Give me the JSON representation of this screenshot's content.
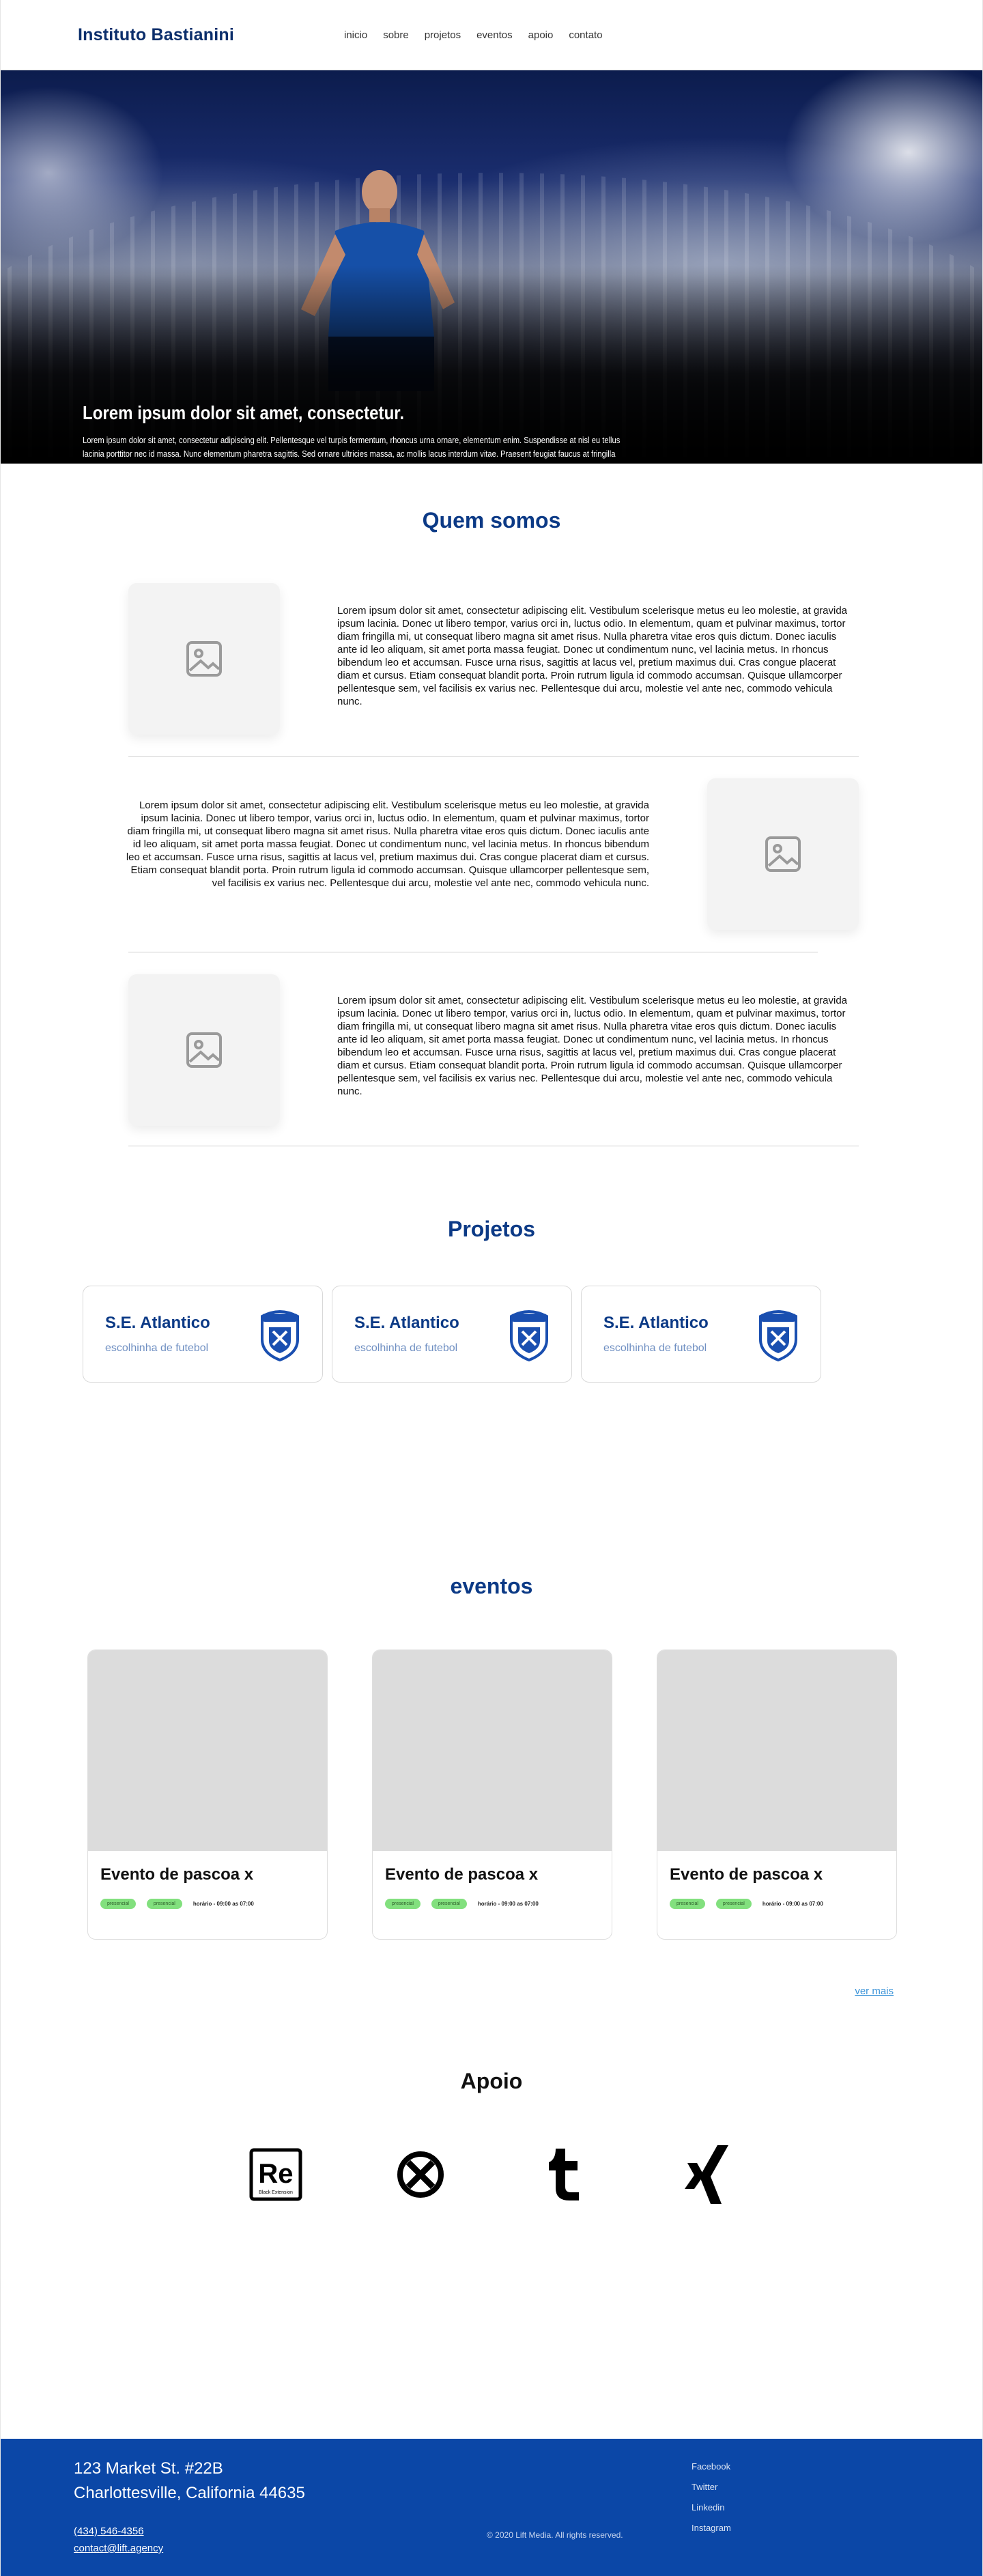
{
  "header": {
    "brand": "Instituto Bastianini",
    "nav": [
      "inicio",
      "sobre",
      "projetos",
      "eventos",
      "apoio",
      "contato"
    ]
  },
  "hero": {
    "title": "Lorem ipsum dolor sit amet, consectetur.",
    "body": "Lorem ipsum dolor sit amet, consectetur adipiscing elit. Pellentesque vel turpis fermentum, rhoncus urna ornare, elementum enim. Suspendisse at nisl eu tellus lacinia porttitor nec id massa. Nunc elementum pharetra sagittis. Sed ornare ultricies massa, ac mollis lacus interdum vitae. Praesent feugiat faucus at fringilla tempor. Cras et vehicula enim, vitae interdum nisi. Vestibulum ac tellus commodo, lacinia nisi non."
  },
  "about": {
    "title": "Quem somos",
    "paragraph": "Lorem ipsum dolor sit amet, consectetur adipiscing elit. Vestibulum scelerisque metus eu leo molestie, at gravida ipsum lacinia. Donec ut libero tempor, varius orci in, luctus odio. In elementum, quam et pulvinar maximus, tortor diam fringilla mi, ut consequat libero magna sit amet risus. Nulla pharetra vitae eros quis dictum. Donec iaculis ante id leo aliquam, sit amet porta massa feugiat. Donec ut condimentum nunc, vel lacinia metus. In rhoncus bibendum leo et accumsan. Fusce urna risus, sagittis at lacus vel, pretium maximus dui. Cras congue placerat diam et cursus. Etiam consequat blandit porta. Proin rutrum ligula id commodo accumsan. Quisque ullamcorper pellentesque sem, vel facilisis ex varius nec. Pellentesque dui arcu, molestie vel ante nec, commodo vehicula nunc."
  },
  "projects": {
    "title": "Projetos",
    "items": [
      {
        "name": "S.E. Atlantico",
        "subtitle": "escolhinha de futebol"
      },
      {
        "name": "S.E. Atlantico",
        "subtitle": "escolhinha de futebol"
      },
      {
        "name": "S.E. Atlantico",
        "subtitle": "escolhinha de futebol"
      }
    ]
  },
  "events": {
    "title": "eventos",
    "items": [
      {
        "name": "Evento de pascoa x",
        "tags": [
          "presencial",
          "presencial"
        ],
        "hours": "horário - 09:00 as 07:00"
      },
      {
        "name": "Evento de pascoa x",
        "tags": [
          "presencial",
          "presencial"
        ],
        "hours": "horário - 09:00 as 07:00"
      },
      {
        "name": "Evento de pascoa x",
        "tags": [
          "presencial",
          "presencial"
        ],
        "hours": "horário - 09:00 as 07:00"
      }
    ],
    "see_more": "ver mais"
  },
  "support": {
    "title": "Apoio",
    "sponsors": [
      "re-logo",
      "xbox-like-logo",
      "tumblr-logo",
      "xing-logo"
    ],
    "re_caption": "Black Extension"
  },
  "footer": {
    "address_line1": "123 Market St. #22B",
    "address_line2": "Charlottesville, California 44635",
    "phone": "(434) 546-4356",
    "email": "contact@lift.agency",
    "copyright": "© 2020 Lift Media. All rights reserved.",
    "social": [
      "Facebook",
      "Twitter",
      "Linkedin",
      "Instagram"
    ]
  },
  "colors": {
    "brand_blue": "#0c3a86",
    "footer_blue": "#0b47a7",
    "tag_green": "#82e07e",
    "link_blue": "#3a93d8"
  }
}
